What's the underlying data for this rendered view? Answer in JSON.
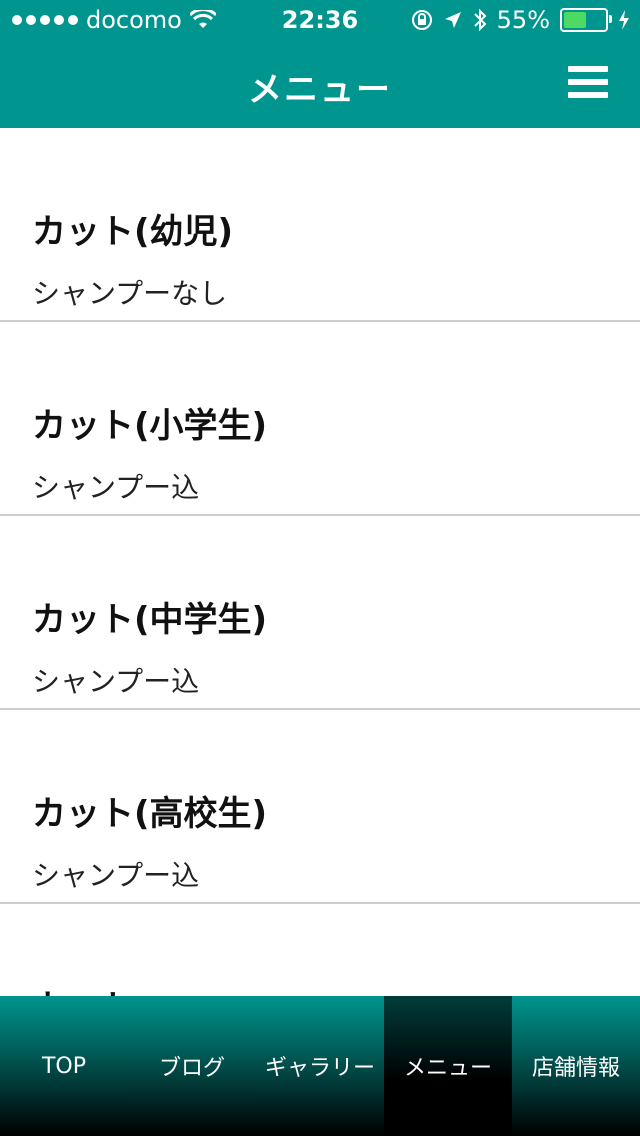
{
  "status_bar": {
    "carrier": "docomo",
    "time": "22:36",
    "battery": "55%"
  },
  "header": {
    "title": "メニュー"
  },
  "menu_items": [
    {
      "name": "カット(幼児)",
      "desc": "シャンプーなし"
    },
    {
      "name": "カット(小学生)",
      "desc": "シャンプー込"
    },
    {
      "name": "カット(中学生)",
      "desc": "シャンプー込"
    },
    {
      "name": "カット(高校生)",
      "desc": "シャンプー込"
    },
    {
      "name": "カット",
      "desc": ""
    }
  ],
  "tabs": [
    {
      "label": "TOP"
    },
    {
      "label": "ブログ"
    },
    {
      "label": "ギャラリー"
    },
    {
      "label": "メニュー",
      "active": true
    },
    {
      "label": "店舗情報"
    }
  ],
  "colors": {
    "header_bg": "#00968f",
    "battery_fill": "#4cd964"
  }
}
